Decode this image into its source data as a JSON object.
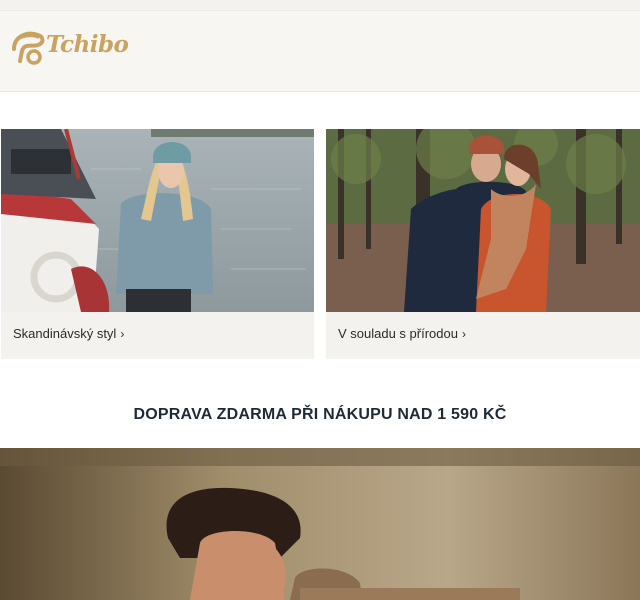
{
  "brand": {
    "name": "Tchibo",
    "color": "#c9a35f"
  },
  "teasers": [
    {
      "label": "Skandinávský styl",
      "chevron": "›"
    },
    {
      "label": "V souladu s přírodou",
      "chevron": "›"
    }
  ],
  "promo": {
    "text": "DOPRAVA ZDARMA PŘI NÁKUPU NAD 1 590 KČ"
  }
}
